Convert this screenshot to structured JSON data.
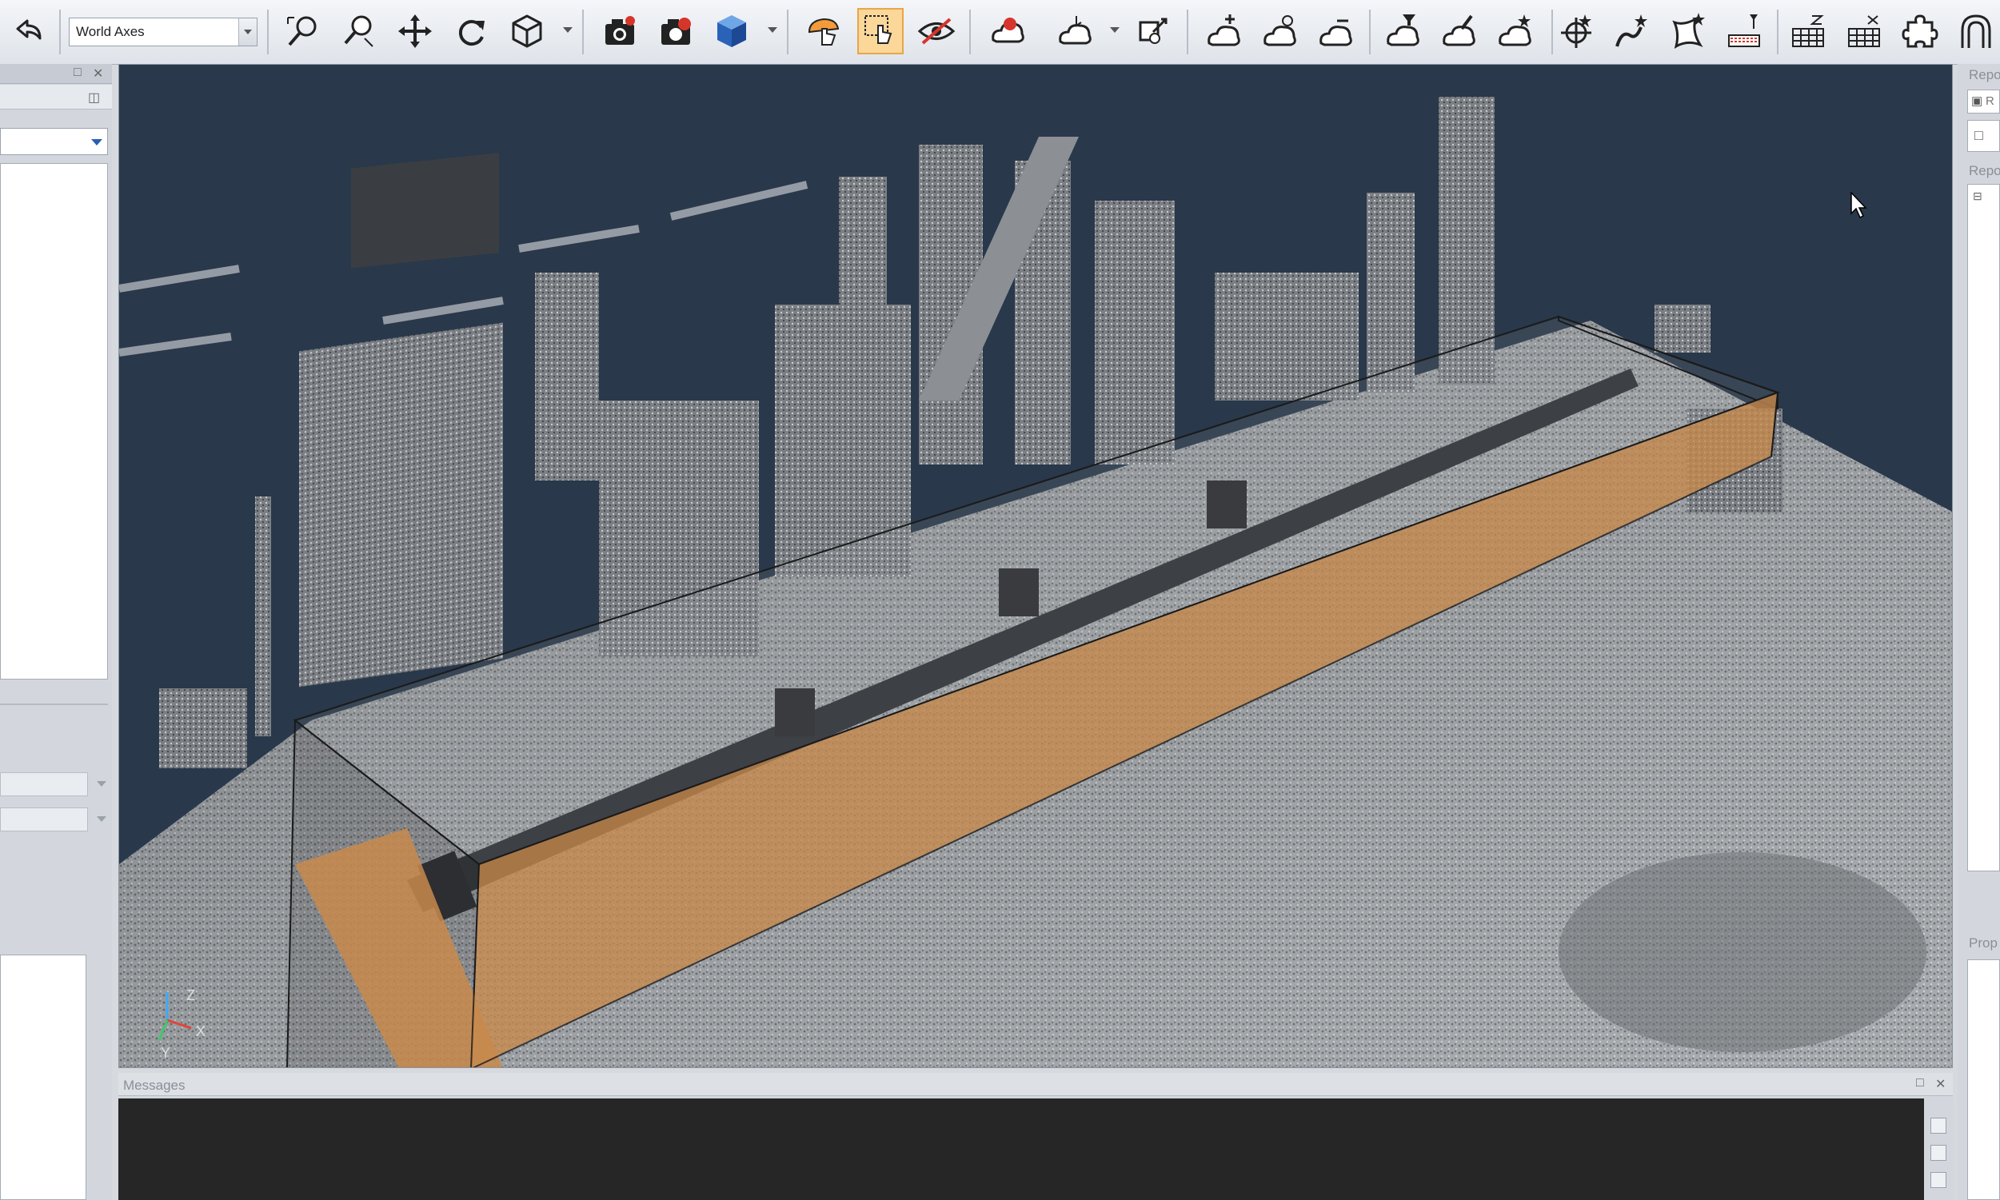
{
  "toolbar": {
    "coordinate_system": "World Axes",
    "tools": [
      {
        "id": "undo",
        "icon": "undo-icon"
      },
      {
        "id": "zoom-fit",
        "icon": "zoom-extents-icon"
      },
      {
        "id": "zoom-window",
        "icon": "zoom-window-icon"
      },
      {
        "id": "pan",
        "icon": "pan-icon"
      },
      {
        "id": "rotate",
        "icon": "rotate-icon"
      },
      {
        "id": "view-cube",
        "icon": "view-cube-icon"
      },
      {
        "id": "capture-snapshot",
        "icon": "camera-icon"
      },
      {
        "id": "record-snapshot",
        "icon": "camera-red-icon"
      },
      {
        "id": "solid-box",
        "icon": "solid-cube-icon"
      },
      {
        "id": "hand-pick",
        "icon": "hand-pick-icon"
      },
      {
        "id": "select-pick",
        "icon": "pointer-select-icon",
        "active": true
      },
      {
        "id": "visibility",
        "icon": "eye-hide-icon"
      },
      {
        "id": "fence",
        "icon": "fence-red-icon"
      },
      {
        "id": "cloud-pick",
        "icon": "cloud-pick-icon"
      },
      {
        "id": "cloud-measure",
        "icon": "cloud-measure-icon"
      },
      {
        "id": "cloud-add",
        "icon": "cloud-add-icon"
      },
      {
        "id": "cloud-edit",
        "icon": "cloud-edit-icon"
      },
      {
        "id": "cloud-remove",
        "icon": "cloud-remove-icon"
      },
      {
        "id": "cloud-filter",
        "icon": "cloud-filter-icon"
      },
      {
        "id": "cloud-brush",
        "icon": "cloud-brush-icon"
      },
      {
        "id": "cloud-star",
        "icon": "cloud-star-icon"
      },
      {
        "id": "fit-target",
        "icon": "fit-target-icon"
      },
      {
        "id": "fit-edge",
        "icon": "fit-edge-icon"
      },
      {
        "id": "fit-patch",
        "icon": "fit-patch-icon"
      },
      {
        "id": "section",
        "icon": "section-icon"
      },
      {
        "id": "mesh-a",
        "icon": "mesh-icon"
      },
      {
        "id": "mesh-b",
        "icon": "mesh-grid-icon"
      },
      {
        "id": "puzzle",
        "icon": "puzzle-icon"
      },
      {
        "id": "arch",
        "icon": "arch-icon"
      }
    ]
  },
  "viewport": {
    "background": "#29384a",
    "box_fill": "#c98a4c",
    "axes": {
      "z": "Z",
      "y": "Y",
      "x": "X"
    }
  },
  "messages": {
    "title": "Messages"
  },
  "right_panel": {
    "labels": [
      "Repo",
      "R",
      "Repo",
      "Prop"
    ]
  }
}
